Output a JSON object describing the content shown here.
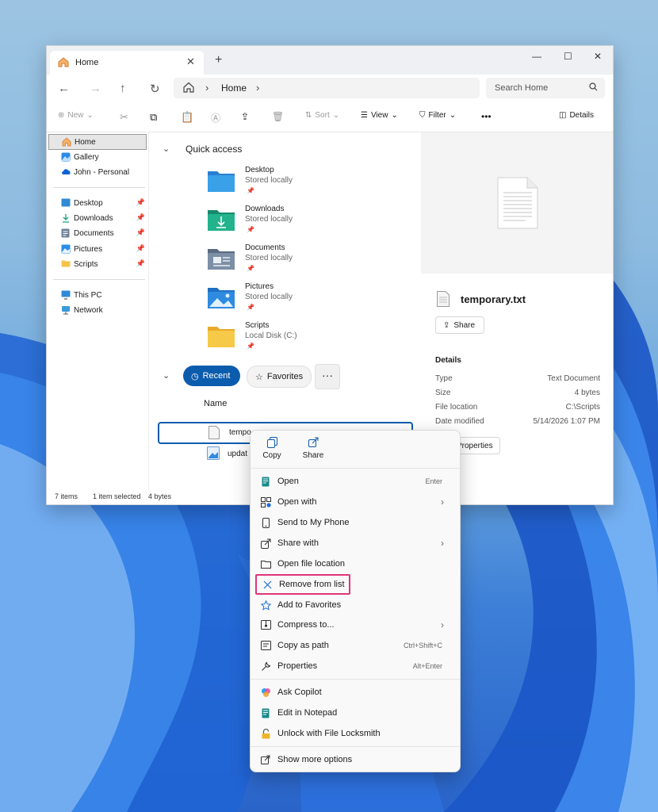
{
  "window": {
    "tab_title": "Home",
    "new_tab": "+",
    "close_tab": "✕"
  },
  "address": {
    "crumb": "Home",
    "search_placeholder": "Search Home"
  },
  "toolbar": {
    "new": "New",
    "sort": "Sort",
    "view": "View",
    "filter": "Filter",
    "more": "•••",
    "details": "Details"
  },
  "sidebar": {
    "top": [
      "Home",
      "Gallery",
      "John - Personal"
    ],
    "pinned": [
      "Desktop",
      "Downloads",
      "Documents",
      "Pictures",
      "Scripts"
    ],
    "bottom": [
      "This PC",
      "Network"
    ]
  },
  "quick_access": {
    "title": "Quick access",
    "items": [
      {
        "name": "Desktop",
        "sub": "Stored locally"
      },
      {
        "name": "Downloads",
        "sub": "Stored locally"
      },
      {
        "name": "Documents",
        "sub": "Stored locally"
      },
      {
        "name": "Pictures",
        "sub": "Stored locally"
      },
      {
        "name": "Scripts",
        "sub": "Local Disk (C:)"
      }
    ]
  },
  "recent": {
    "recent_label": "Recent",
    "favorites_label": "Favorites",
    "more": "···",
    "column_name": "Name",
    "rows": [
      "tempo",
      "updat"
    ]
  },
  "details": {
    "file_name": "temporary.txt",
    "share": "Share",
    "header": "Details",
    "props": [
      {
        "k": "Type",
        "v": "Text Document"
      },
      {
        "k": "Size",
        "v": "4 bytes"
      },
      {
        "k": "File location",
        "v": "C:\\Scripts"
      },
      {
        "k": "Date modified",
        "v": "5/14/2026 1:07 PM"
      }
    ],
    "properties_button": "Properties"
  },
  "status": {
    "items": "7 items",
    "selected": "1 item selected",
    "size": "4 bytes"
  },
  "context_menu": {
    "top": {
      "copy": "Copy",
      "share": "Share"
    },
    "items": [
      {
        "label": "Open",
        "shortcut": "Enter"
      },
      {
        "label": "Open with",
        "arrow": "›"
      },
      {
        "label": "Send to My Phone"
      },
      {
        "label": "Share with",
        "arrow": "›"
      },
      {
        "label": "Open file location"
      },
      {
        "label": "Remove from list"
      },
      {
        "label": "Add to Favorites"
      },
      {
        "label": "Compress to...",
        "arrow": "›"
      },
      {
        "label": "Copy as path",
        "shortcut": "Ctrl+Shift+C"
      },
      {
        "label": "Properties",
        "shortcut": "Alt+Enter"
      }
    ],
    "items2": [
      {
        "label": "Ask Copilot"
      },
      {
        "label": "Edit in Notepad"
      },
      {
        "label": "Unlock with File Locksmith"
      }
    ],
    "more_options": "Show more options"
  },
  "colors": {
    "accent": "#0b5cad",
    "highlight": "#e0357a"
  }
}
